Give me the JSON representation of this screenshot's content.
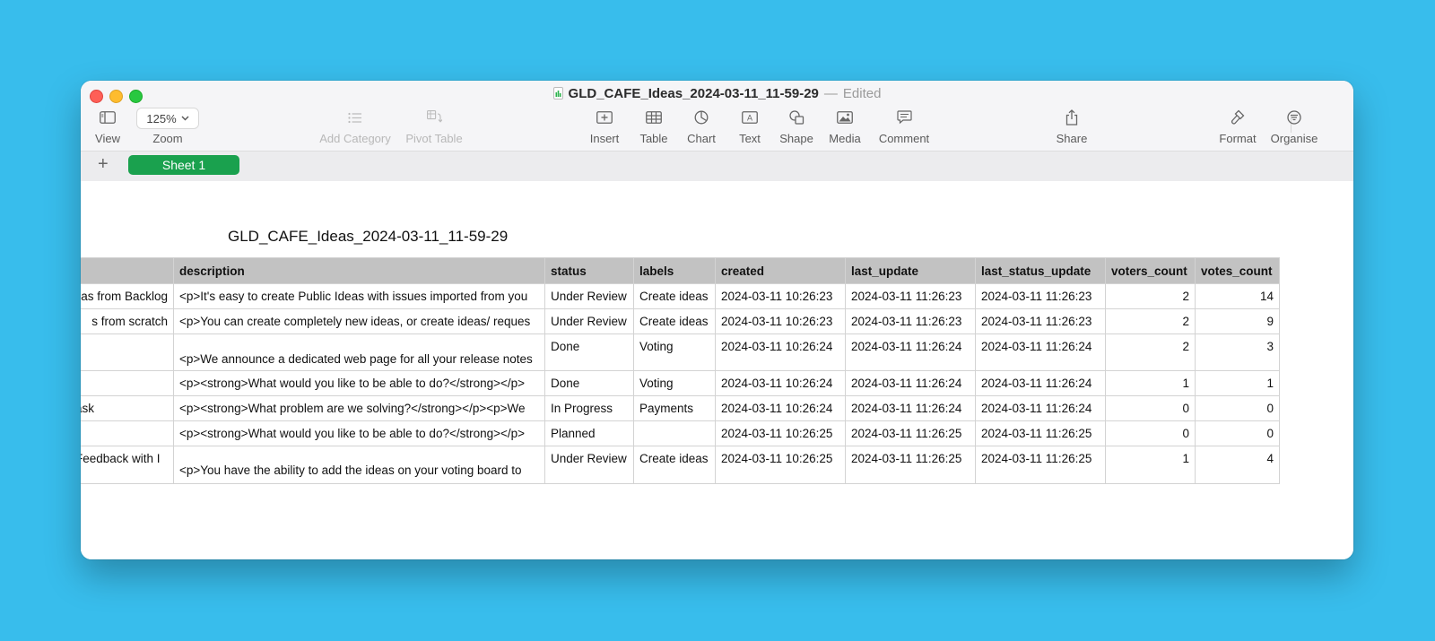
{
  "window": {
    "title": "GLD_CAFE_Ideas_2024-03-11_11-59-29",
    "separator": "—",
    "status": "Edited"
  },
  "toolbar": {
    "view": "View",
    "zoom_label": "Zoom",
    "zoom_value": "125%",
    "add_category": "Add Category",
    "pivot_table": "Pivot Table",
    "insert": "Insert",
    "table": "Table",
    "chart": "Chart",
    "text": "Text",
    "shape": "Shape",
    "media": "Media",
    "comment": "Comment",
    "share": "Share",
    "format": "Format",
    "organise": "Organise"
  },
  "sheets": {
    "add": "+",
    "tabs": [
      "Sheet 1"
    ]
  },
  "table": {
    "title": "GLD_CAFE_Ideas_2024-03-11_11-59-29",
    "columns": [
      "",
      "description",
      "status",
      "labels",
      "created",
      "last_update",
      "last_status_update",
      "voters_count",
      "votes_count"
    ],
    "rows": [
      [
        "as from Backlog",
        "<p>It's easy to create Public Ideas with issues imported from you",
        "Under Review",
        "Create ideas",
        "2024-03-11 10:26:23",
        "2024-03-11 11:26:23",
        "2024-03-11 11:26:23",
        "2",
        "14"
      ],
      [
        "s from scratch",
        "<p>You can create completely new ideas, or create ideas/ reques",
        "Under Review",
        "Create ideas",
        "2024-03-11 10:26:23",
        "2024-03-11 11:26:23",
        "2024-03-11 11:26:23",
        "2",
        "9"
      ],
      [
        "",
        "<p>We announce a dedicated web page for all your release notes",
        "Done",
        "Voting",
        "2024-03-11 10:26:24",
        "2024-03-11 11:26:24",
        "2024-03-11 11:26:24",
        "2",
        "3"
      ],
      [
        "",
        "<p><strong>What would you like to be able to do?</strong></p>",
        "Done",
        "Voting",
        "2024-03-11 10:26:24",
        "2024-03-11 11:26:24",
        "2024-03-11 11:26:24",
        "1",
        "1"
      ],
      [
        "ask",
        "<p><strong>What problem are we solving?</strong></p><p>We",
        "In Progress",
        "Payments",
        "2024-03-11 10:26:24",
        "2024-03-11 11:26:24",
        "2024-03-11 11:26:24",
        "0",
        "0"
      ],
      [
        "",
        "<p><strong>What would you like to be able to do?</strong></p>",
        "Planned",
        "",
        "2024-03-11 10:26:25",
        "2024-03-11 11:26:25",
        "2024-03-11 11:26:25",
        "0",
        "0"
      ],
      [
        "Feedback with I",
        "<p>You have the ability to add the ideas on your voting board to",
        "Under Review",
        "Create ideas",
        "2024-03-11 10:26:25",
        "2024-03-11 11:26:25",
        "2024-03-11 11:26:25",
        "1",
        "4"
      ]
    ]
  }
}
